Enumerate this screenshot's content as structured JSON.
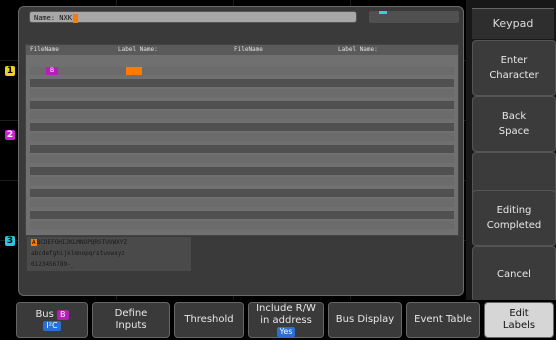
{
  "dialog": {
    "name_label": "Name: NXK",
    "columns": [
      "FileName",
      "Label Name:",
      "FileName",
      "Label Name:"
    ],
    "row0_badge": "B",
    "keypad_lines": [
      [
        "A",
        "BCDEFGHIJKLMNOPQRSTUVWXYZ"
      ],
      [
        "",
        "abcdefghijklmnopqrstuvwxyz"
      ],
      [
        "",
        "0123456789-_"
      ]
    ]
  },
  "channel_markers": [
    "1",
    "2",
    "3"
  ],
  "side_menu": {
    "title": "Keypad",
    "buttons": [
      {
        "line1": "Enter",
        "line2": "Character"
      },
      {
        "line1": "Back",
        "line2": "Space"
      },
      {
        "line1": "",
        "line2": ""
      },
      {
        "line1": "Editing",
        "line2": "Completed"
      },
      {
        "line1": "Cancel",
        "line2": ""
      }
    ]
  },
  "bottom_menu": {
    "bus": {
      "label": "Bus",
      "badge": "B",
      "value": "I²C"
    },
    "define_inputs": {
      "line1": "Define",
      "line2": "Inputs"
    },
    "threshold": "Threshold",
    "include_rw": {
      "line1": "Include R/W",
      "line2": "in address",
      "value": "Yes"
    },
    "bus_display": "Bus Display",
    "event_table": "Event Table",
    "edit_labels": {
      "line1": "Edit",
      "line2": "Labels"
    }
  },
  "colors": {
    "accent_orange": "#ff7b00",
    "channel1": "#f0d020",
    "channel2": "#d020d8",
    "channel3": "#28c8e0",
    "bus_badge": "#b41fb8",
    "value_pill": "#2b6fd6"
  }
}
